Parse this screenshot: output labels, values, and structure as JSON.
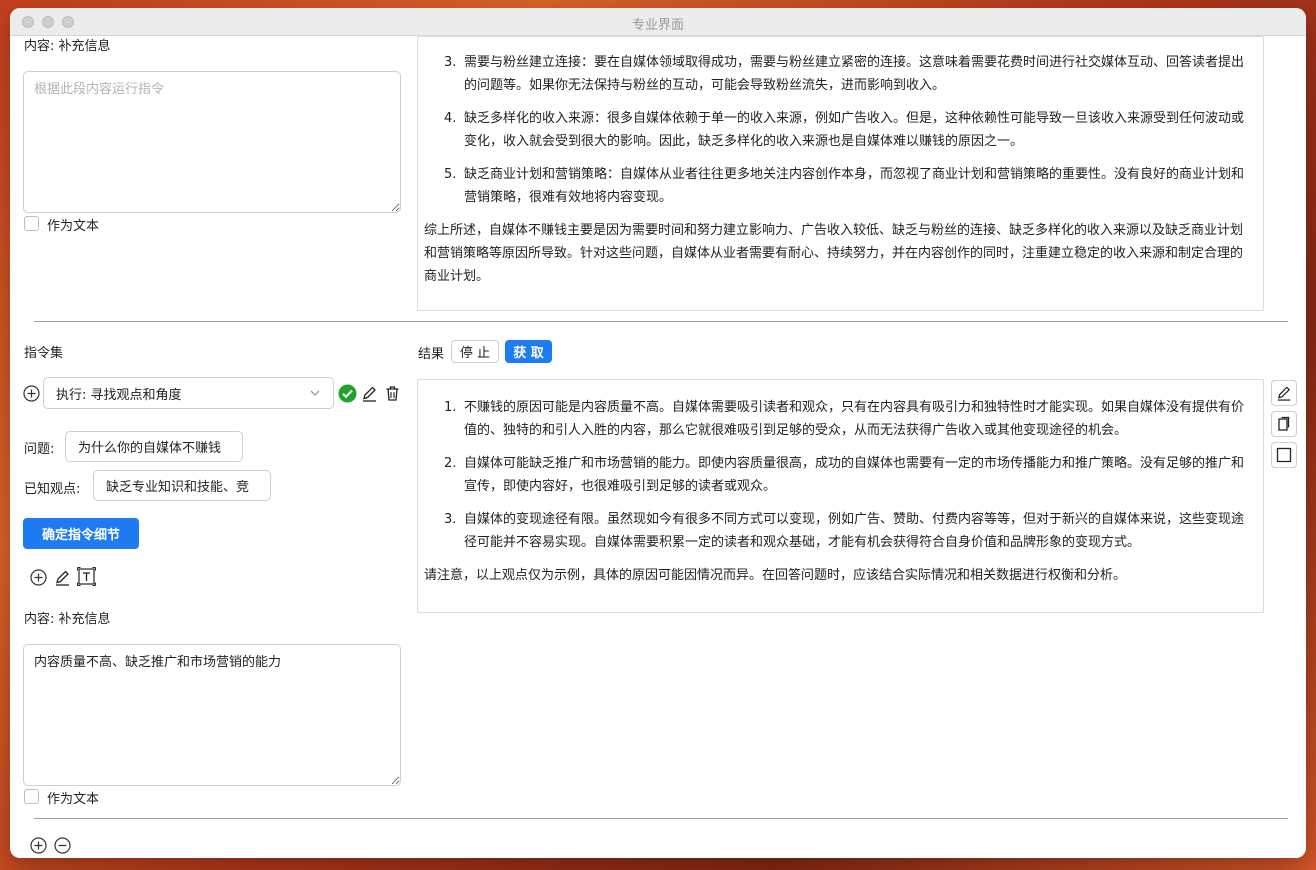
{
  "window": {
    "title": "专业界面"
  },
  "top": {
    "content_label": "内容: 补充信息",
    "input_placeholder": "根据此段内容运行指令",
    "as_text_label": "作为文本",
    "panel": {
      "items": [
        {
          "num": "3.",
          "text": "需要与粉丝建立连接：要在自媒体领域取得成功，需要与粉丝建立紧密的连接。这意味着需要花费时间进行社交媒体互动、回答读者提出的问题等。如果你无法保持与粉丝的互动，可能会导致粉丝流失，进而影响到收入。"
        },
        {
          "num": "4.",
          "text": "缺乏多样化的收入来源：很多自媒体依赖于单一的收入来源，例如广告收入。但是，这种依赖性可能导致一旦该收入来源受到任何波动或变化，收入就会受到很大的影响。因此，缺乏多样化的收入来源也是自媒体难以赚钱的原因之一。"
        },
        {
          "num": "5.",
          "text": "缺乏商业计划和营销策略：自媒体从业者往往更多地关注内容创作本身，而忽视了商业计划和营销策略的重要性。没有良好的商业计划和营销策略，很难有效地将内容变现。"
        }
      ],
      "summary": "综上所述，自媒体不赚钱主要是因为需要时间和努力建立影响力、广告收入较低、缺乏与粉丝的连接、缺乏多样化的收入来源以及缺乏商业计划和营销策略等原因所导致。针对这些问题，自媒体从业者需要有耐心、持续努力，并在内容创作的同时，注重建立稳定的收入来源和制定合理的商业计划。"
    }
  },
  "commands": {
    "label": "指令集",
    "select_value": "执行: 寻找观点和角度",
    "question_label": "问题:",
    "question_value": "为什么你的自媒体不赚钱",
    "known_label": "已知观点:",
    "known_value": "缺乏专业知识和技能、竞",
    "confirm_button": "确定指令细节",
    "content_label": "内容: 补充信息",
    "content_value": "内容质量不高、缺乏推广和市场营销的能力",
    "as_text_label": "作为文本"
  },
  "results": {
    "label": "结果",
    "stop_button": "停 止",
    "fetch_button": "获 取",
    "items": [
      {
        "num": "1.",
        "text": "不赚钱的原因可能是内容质量不高。自媒体需要吸引读者和观众，只有在内容具有吸引力和独特性时才能实现。如果自媒体没有提供有价值的、独特的和引人入胜的内容，那么它就很难吸引到足够的受众，从而无法获得广告收入或其他变现途径的机会。"
      },
      {
        "num": "2.",
        "text": "自媒体可能缺乏推广和市场营销的能力。即使内容质量很高，成功的自媒体也需要有一定的市场传播能力和推广策略。没有足够的推广和宣传，即使内容好，也很难吸引到足够的读者或观众。"
      },
      {
        "num": "3.",
        "text": "自媒体的变现途径有限。虽然现如今有很多不同方式可以变现，例如广告、赞助、付费内容等等，但对于新兴的自媒体来说，这些变现途径可能并不容易实现。自媒体需要积累一定的读者和观众基础，才能有机会获得符合自身价值和品牌形象的变现方式。"
      }
    ],
    "summary": "请注意，以上观点仅为示例，具体的原因可能因情况而异。在回答问题时，应该结合实际情况和相关数据进行权衡和分析。"
  },
  "colors": {
    "accent": "#1e7bf2",
    "success": "#1fa32e"
  }
}
